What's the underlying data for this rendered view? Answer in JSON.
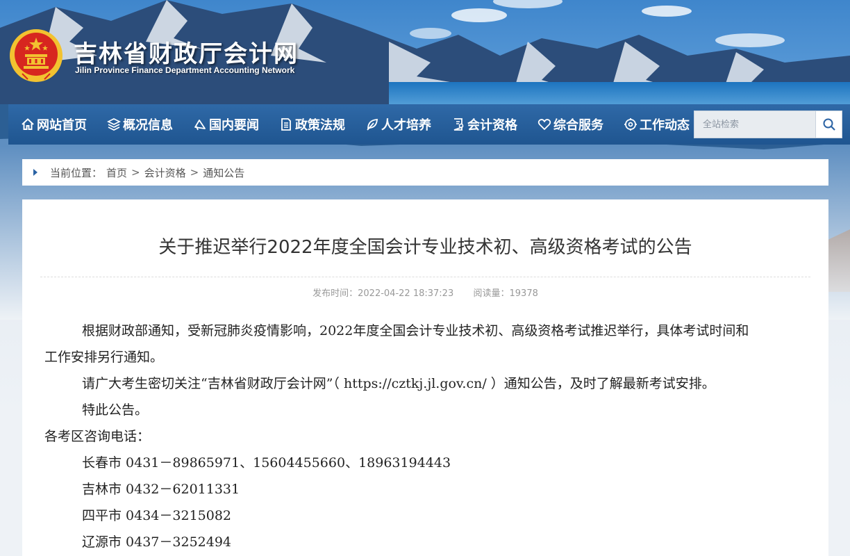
{
  "header": {
    "title": "吉林省财政厅会计网",
    "subtitle": "Jilin Province Finance Department Accounting Network"
  },
  "nav": {
    "items": [
      {
        "label": "网站首页",
        "icon": "home-icon"
      },
      {
        "label": "概况信息",
        "icon": "layers-icon"
      },
      {
        "label": "国内要闻",
        "icon": "megaphone-icon"
      },
      {
        "label": "政策法规",
        "icon": "document-icon"
      },
      {
        "label": "人才培养",
        "icon": "leaf-icon"
      },
      {
        "label": "会计资格",
        "icon": "certificate-icon"
      },
      {
        "label": "综合服务",
        "icon": "heart-icon"
      },
      {
        "label": "工作动态",
        "icon": "gear-icon"
      }
    ],
    "search_placeholder": "全站检索"
  },
  "breadcrumb": {
    "label": "当前位置：",
    "items": [
      "首页",
      "会计资格",
      "通知公告"
    ],
    "separator": ">"
  },
  "article": {
    "title": "关于推迟举行2022年度全国会计专业技术初、高级资格考试的公告",
    "publish_time": "发布时间：2022-04-22 18:37:23",
    "read_count": "阅读量：19378",
    "paragraph1_line1": "根据财政部通知，受新冠肺炎疫情影响，2022年度全国会计专业技术初、高级资格考试推迟举行，具体考试时间和",
    "paragraph1_line2": "工作安排另行通知。",
    "paragraph2": "请广大考生密切关注“吉林省财政厅会计网”（ https://cztkj.jl.gov.cn/ ）通知公告，及时了解最新考试安排。",
    "paragraph3": "特此公告。",
    "contacts_heading": "各考区咨询电话：",
    "contacts": [
      "长春市 0431－89865971、15604455660、18963194443",
      "吉林市 0432－62011331",
      "四平市 0434－3215082",
      "辽源市 0437－3252494"
    ]
  },
  "colors": {
    "nav_bg": "#2366a4",
    "accent": "#2b63a4",
    "emblem_red": "#d7261f",
    "emblem_gold": "#f2c230"
  }
}
